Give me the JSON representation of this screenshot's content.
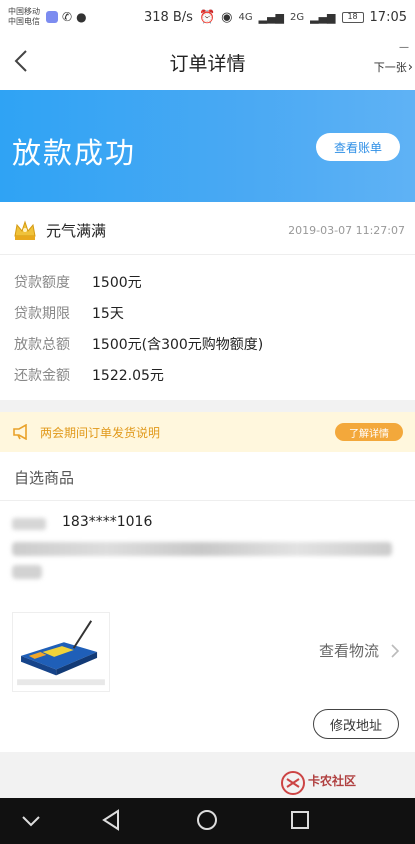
{
  "status_bar": {
    "carrier1": "中国移动",
    "carrier2": "中国电信",
    "speed": "318 B/s",
    "net1": "4G",
    "net2": "2G",
    "battery": "18",
    "time": "17:05"
  },
  "nav": {
    "title": "订单详情",
    "next_label": "下一张",
    "next_icon": "›",
    "top_mark": "—"
  },
  "banner": {
    "title": "放款成功",
    "bill_button": "查看账单"
  },
  "merchant": {
    "name": "元气满满",
    "time": "2019-03-07 11:27:07"
  },
  "loan_rows": [
    {
      "label": "贷款额度",
      "value": "1500元"
    },
    {
      "label": "贷款期限",
      "value": "15天"
    },
    {
      "label": "放款总额",
      "value": "1500元(含300元购物额度)"
    },
    {
      "label": "还款金额",
      "value": "1522.05元"
    }
  ],
  "notice": {
    "text": "两会期间订单发货说明",
    "button": "了解详情"
  },
  "goods": {
    "title": "自选商品",
    "phone": "183****1016",
    "logistics": "查看物流",
    "modify_address": "修改地址"
  },
  "watermark": {
    "text": "卡农社区"
  },
  "colors": {
    "banner_blue": "#2fa3f4",
    "notice_orange": "#f3a83b",
    "notice_bg": "#fff7dd"
  }
}
